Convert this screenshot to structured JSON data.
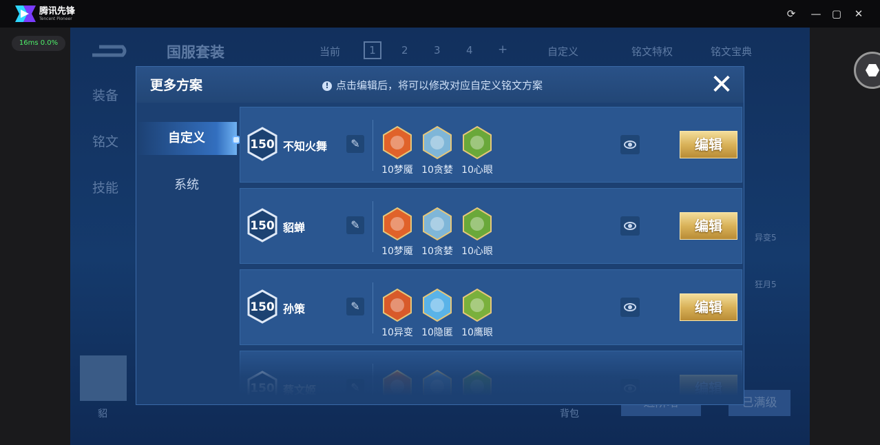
{
  "app": {
    "title": "腾讯先锋",
    "subtitle": "Tencent Pioneer",
    "stats": "16ms 0.0%",
    "window_buttons": [
      "refresh-icon",
      "minimize-icon",
      "maximize-icon",
      "close-icon"
    ]
  },
  "background": {
    "title": "国服套装",
    "tabs": [
      "当前",
      "1",
      "2",
      "3",
      "4",
      "+"
    ],
    "custom_label": "自定义",
    "privilege_label": "铭文特权",
    "guide_label": "铭文宝典",
    "menu": [
      "装备",
      "铭文",
      "技能"
    ],
    "right_labels": [
      "异变5",
      "狂月5"
    ],
    "bottom_left_label": "貂",
    "bottom_center_label": "背包",
    "bottom_buttons": [
      "进阶培",
      "已满级"
    ]
  },
  "modal": {
    "title": "更多方案",
    "tip": "点击编辑后，将可以修改对应自定义铭文方案",
    "tabs": [
      {
        "label": "自定义",
        "active": true
      },
      {
        "label": "系统",
        "active": false
      }
    ],
    "rows": [
      {
        "level": "150",
        "name": "不知火舞",
        "inscriptions": [
          {
            "label": "10梦魇",
            "color": "#e0622a"
          },
          {
            "label": "10贪婪",
            "color": "#7fb6d8"
          },
          {
            "label": "10心眼",
            "color": "#6aa83a"
          }
        ],
        "edit": "编辑"
      },
      {
        "level": "150",
        "name": "貂蝉",
        "inscriptions": [
          {
            "label": "10梦魇",
            "color": "#e0622a"
          },
          {
            "label": "10贪婪",
            "color": "#7fb6d8"
          },
          {
            "label": "10心眼",
            "color": "#6aa83a"
          }
        ],
        "edit": "编辑"
      },
      {
        "level": "150",
        "name": "孙策",
        "inscriptions": [
          {
            "label": "10异变",
            "color": "#d85a2a"
          },
          {
            "label": "10隐匿",
            "color": "#5ab3e8"
          },
          {
            "label": "10鹰眼",
            "color": "#7ab03c"
          }
        ],
        "edit": "编辑"
      },
      {
        "level": "150",
        "name": "蔡文姬",
        "inscriptions": [
          {
            "label": "",
            "color": "#c66a3a"
          },
          {
            "label": "",
            "color": "#6a9cc8"
          },
          {
            "label": "",
            "color": "#6aa83a"
          }
        ],
        "edit": "编辑"
      }
    ]
  },
  "colors": {
    "accent": "#2a5690",
    "gold": "#d9b259",
    "fps_green": "#4ef06a"
  }
}
